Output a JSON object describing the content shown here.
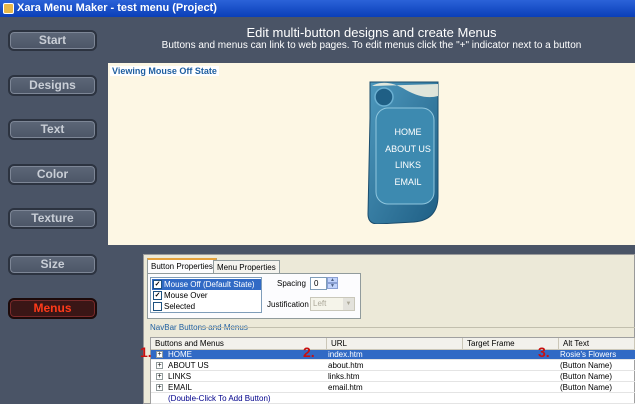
{
  "window": {
    "title": "Xara Menu Maker - test menu (Project)"
  },
  "nav": {
    "items": [
      {
        "label": "Start",
        "active": false
      },
      {
        "label": "Designs",
        "active": false
      },
      {
        "label": "Text",
        "active": false
      },
      {
        "label": "Color",
        "active": false
      },
      {
        "label": "Texture",
        "active": false
      },
      {
        "label": "Size",
        "active": false
      },
      {
        "label": "Menus",
        "active": true
      }
    ]
  },
  "header": {
    "title": "Edit multi-button designs and create Menus",
    "subtitle": "Buttons and menus can link to web pages. To edit menus click the \"+\" indicator next to a button"
  },
  "preview": {
    "state_label": "Viewing Mouse Off State",
    "menu_items": [
      "HOME",
      "ABOUT US",
      "LINKS",
      "EMAIL"
    ]
  },
  "tabs": [
    {
      "label": "Button Properties",
      "active": true
    },
    {
      "label": "Menu Properties",
      "active": false
    }
  ],
  "button_states": [
    {
      "label": "Mouse Off (Default State)",
      "checked": true,
      "selected": true
    },
    {
      "label": "Mouse Over",
      "checked": true,
      "selected": false
    },
    {
      "label": "Selected",
      "checked": false,
      "selected": false
    }
  ],
  "spacing": {
    "label": "Spacing",
    "value": "0"
  },
  "justification": {
    "label": "Justification",
    "value": "Left"
  },
  "group_label": "NavBar Buttons and Menus",
  "grid": {
    "columns": [
      "Buttons and Menus",
      "URL",
      "Target Frame",
      "Alt Text"
    ],
    "rows": [
      {
        "name": "HOME",
        "url": "index.htm",
        "target": "",
        "alt": "Rosie's Flowers",
        "selected": true
      },
      {
        "name": "ABOUT US",
        "url": "about.htm",
        "target": "",
        "alt": "(Button Name)",
        "selected": false
      },
      {
        "name": "LINKS",
        "url": "links.htm",
        "target": "",
        "alt": "(Button Name)",
        "selected": false
      },
      {
        "name": "EMAIL",
        "url": "email.htm",
        "target": "",
        "alt": "(Button Name)",
        "selected": false
      }
    ],
    "add_row": "(Double-Click To Add Button)",
    "expander_symbol": "+"
  },
  "callouts": [
    "1.",
    "2.",
    "3."
  ],
  "colors": {
    "panel_bg": "#4a5466",
    "accent_red": "#c81010",
    "selection_blue": "#316ac5",
    "menu_graphic": "#2f7aa0"
  }
}
